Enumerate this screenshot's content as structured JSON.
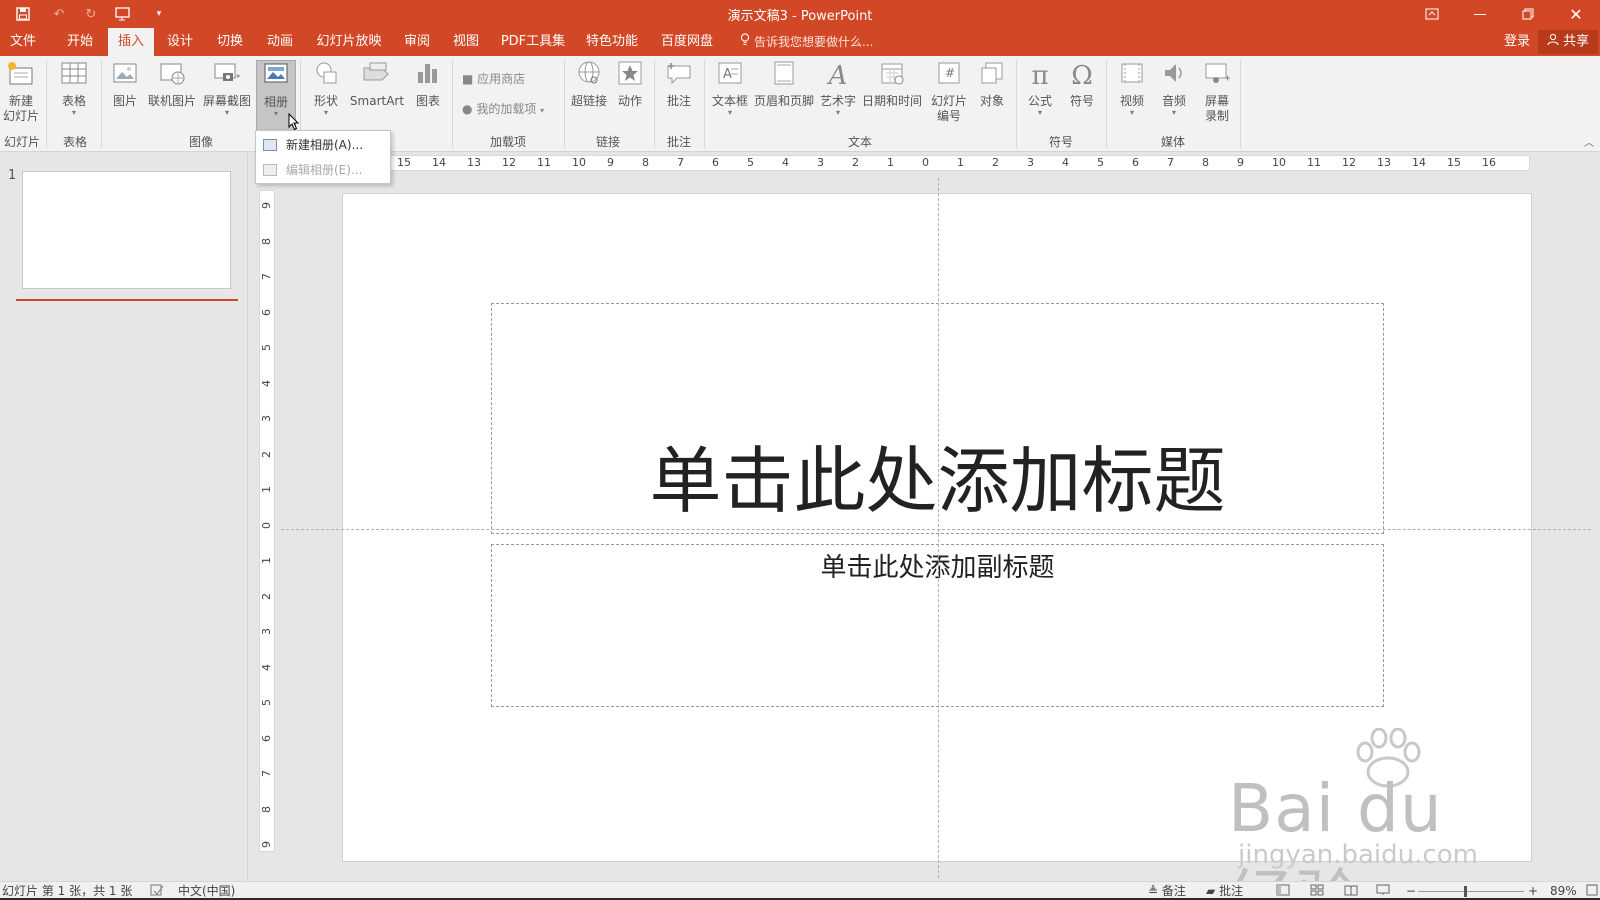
{
  "app": {
    "window_title": "演示文稿3 - PowerPoint",
    "accent_color": "#d24726"
  },
  "qat": {
    "icons": [
      "save-icon",
      "undo-icon",
      "undo-dropdown-icon",
      "redo-icon",
      "start-from-beginning-icon",
      "customize-qat-icon"
    ]
  },
  "window_controls": {
    "icons": [
      "ribbon-display-options-icon",
      "minimize-icon",
      "restore-icon",
      "close-icon"
    ]
  },
  "tabs": [
    {
      "label": "文件"
    },
    {
      "label": "开始"
    },
    {
      "label": "插入",
      "active": true
    },
    {
      "label": "设计"
    },
    {
      "label": "切换"
    },
    {
      "label": "动画"
    },
    {
      "label": "幻灯片放映"
    },
    {
      "label": "审阅"
    },
    {
      "label": "视图"
    },
    {
      "label": "PDF工具集"
    },
    {
      "label": "特色功能"
    },
    {
      "label": "百度网盘"
    }
  ],
  "tell_me": "告诉我您想要做什么...",
  "sign_in": "登录",
  "share": "共享",
  "ribbon": {
    "new_slide": "新建\n幻灯片",
    "table": "表格",
    "picture": "图片",
    "online_picture": "联机图片",
    "screenshot": "屏幕截图",
    "album": "相册",
    "shapes": "形状",
    "smartart": "SmartArt",
    "chart": "图表",
    "store": "应用商店",
    "my_addins": "我的加载项",
    "hyperlink": "超链接",
    "action": "动作",
    "comment": "批注",
    "textbox": "文本框",
    "header_footer": "页眉和页脚",
    "wordart": "艺术字",
    "datetime": "日期和时间",
    "slide_number": "幻灯片\n编号",
    "object": "对象",
    "equation": "公式",
    "symbol": "符号",
    "video": "视频",
    "audio": "音频",
    "screen_recording": "屏幕\n录制",
    "groups": {
      "slides": "幻灯片",
      "tables": "表格",
      "images": "图像",
      "addins": "加载项",
      "links": "链接",
      "comments": "批注",
      "text": "文本",
      "symbols": "符号",
      "media": "媒体"
    }
  },
  "album_menu": {
    "new_album": "新建相册(A)...",
    "edit_album": "编辑相册(E)..."
  },
  "slide_pane": {
    "slide_number": "1"
  },
  "rulers": {
    "horizontal": [
      "15",
      "14",
      "13",
      "12",
      "11",
      "10",
      "9",
      "8",
      "7",
      "6",
      "5",
      "4",
      "3",
      "2",
      "1",
      "0",
      "1",
      "2",
      "3",
      "4",
      "5",
      "6",
      "7",
      "8",
      "9",
      "10",
      "11",
      "12",
      "13",
      "14",
      "15",
      "16"
    ],
    "vertical": [
      "9",
      "8",
      "7",
      "6",
      "5",
      "4",
      "3",
      "2",
      "1",
      "0",
      "1",
      "2",
      "3",
      "4",
      "5",
      "6",
      "7",
      "8",
      "9"
    ]
  },
  "slide": {
    "title_placeholder": "单击此处添加标题",
    "subtitle_placeholder": "单击此处添加副标题"
  },
  "watermark": {
    "logo": "Bai du 经验",
    "url": "jingyan.baidu.com"
  },
  "status": {
    "slide_info": "幻灯片 第 1 张，共 1 张",
    "language": "中文(中国)",
    "notes": "备注",
    "comments": "批注",
    "zoom": "89%"
  }
}
